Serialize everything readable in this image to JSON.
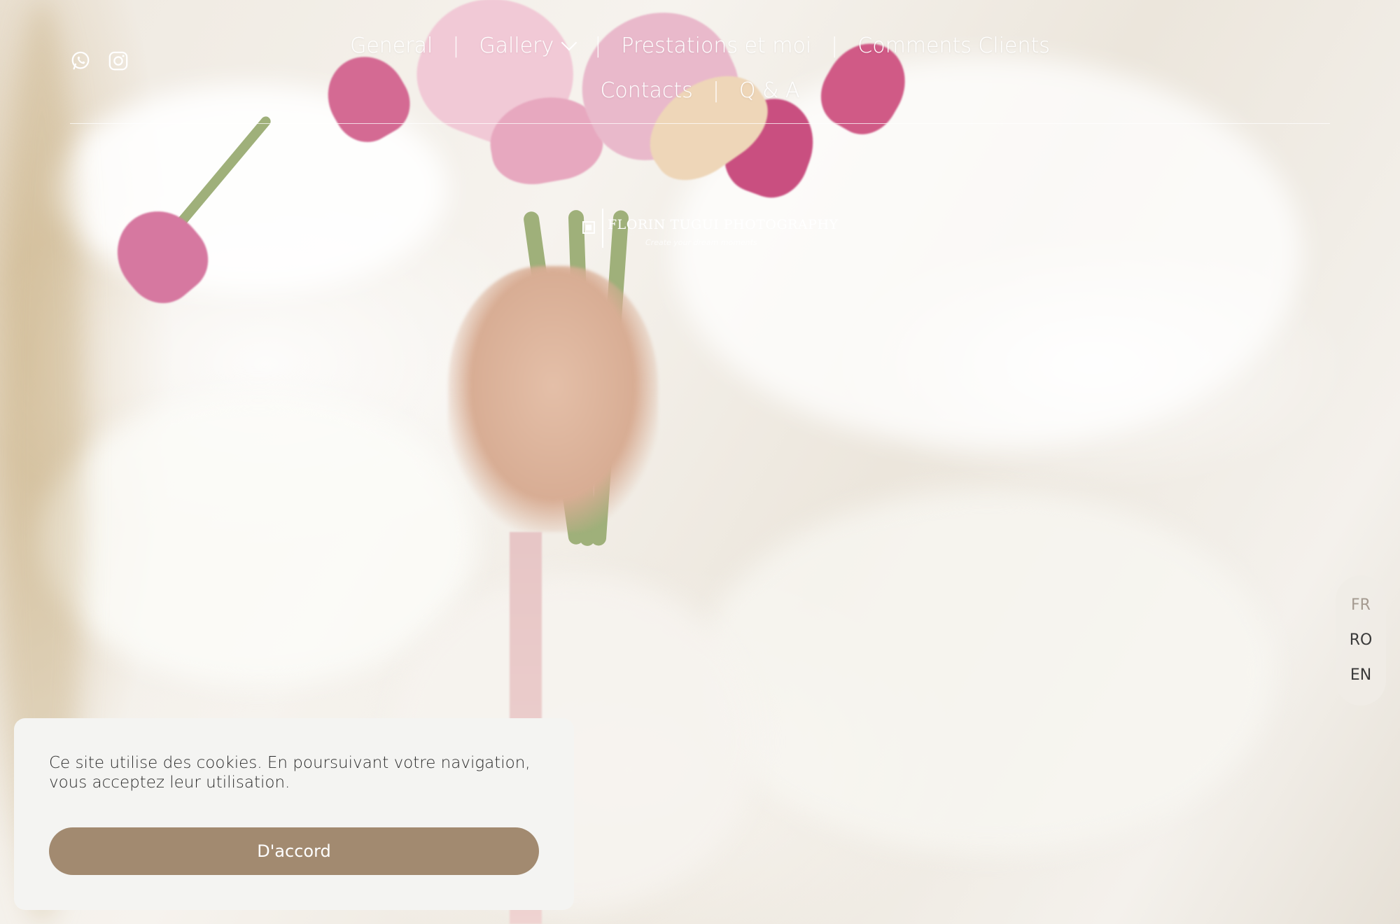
{
  "nav": {
    "items": [
      {
        "label": "General"
      },
      {
        "label": "Gallery"
      },
      {
        "label": "Prestations et moi"
      },
      {
        "label": "Comments Clients"
      },
      {
        "label": "Contacts"
      },
      {
        "label": "Q & A"
      }
    ],
    "separator": "|"
  },
  "social": {
    "icons": [
      "whatsapp-icon",
      "instagram-icon"
    ]
  },
  "logo": {
    "name": "FLORIN TUGUI PHOTOGRAPHY",
    "tagline": "Create your dream moments"
  },
  "language": {
    "options": [
      "FR",
      "RO",
      "EN"
    ],
    "active": "FR"
  },
  "cookie": {
    "message": "Ce site utilise des cookies. En poursuivant votre navigation, vous acceptez leur utilisation.",
    "accept_label": "D'accord"
  },
  "colors": {
    "accent": "#a28a70",
    "banner_bg": "#f4f4f2"
  }
}
